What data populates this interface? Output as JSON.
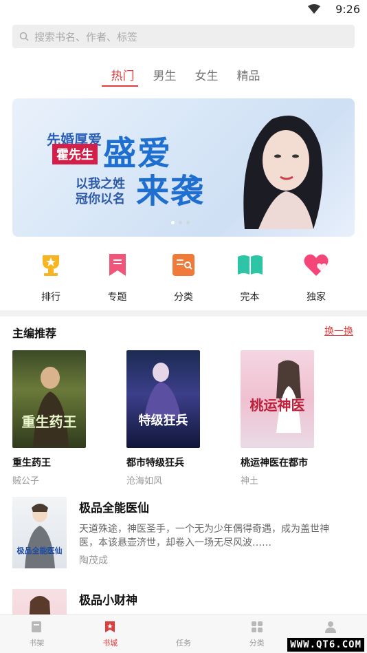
{
  "status": {
    "time": "9:26"
  },
  "search": {
    "placeholder": "搜索书名、作者、标签"
  },
  "tabs": [
    {
      "label": "热门",
      "active": true
    },
    {
      "label": "男生"
    },
    {
      "label": "女生"
    },
    {
      "label": "精品"
    }
  ],
  "banner": {
    "line1": "先婚厚爱",
    "line2": "霍先生",
    "title1": "盛爱",
    "title2": "来袭",
    "sub1": "以我之姓",
    "sub2": "冠你以名"
  },
  "categories": [
    {
      "label": "排行",
      "icon": "trophy-icon",
      "color": "#f7b521"
    },
    {
      "label": "专题",
      "icon": "bookmark-icon",
      "color": "#f0557a"
    },
    {
      "label": "分类",
      "icon": "category-icon",
      "color": "#f07a3a"
    },
    {
      "label": "完本",
      "icon": "open-book-icon",
      "color": "#2ec4a6"
    },
    {
      "label": "独家",
      "icon": "heart-icon",
      "color": "#f5467a"
    }
  ],
  "section": {
    "title": "主编推荐",
    "more": "换一换"
  },
  "grid_books": [
    {
      "name": "重生药王",
      "author": "贼公子",
      "cover_text": "重生药王"
    },
    {
      "name": "都市特级狂兵",
      "author": "沧海如风",
      "cover_text": "特级狂兵"
    },
    {
      "name": "桃运神医在都市",
      "author": "神土",
      "cover_text": "桃运神医"
    }
  ],
  "list_books": [
    {
      "name": "极品全能医仙",
      "desc": "天道殊途，神医圣手，一个无为少年偶得奇遇，成为盖世神医，本该悬壶济世，却卷入一场无尽风波……",
      "author": "陶茂成",
      "cover_text": "极品全能医仙"
    },
    {
      "name": "极品小财神",
      "desc": "",
      "author": "",
      "cover_text": ""
    }
  ],
  "bottom_nav": [
    {
      "label": "书架",
      "icon": "bookshelf-icon"
    },
    {
      "label": "书城",
      "icon": "bookstore-icon",
      "active": true
    },
    {
      "label": "任务",
      "icon": "task-icon"
    },
    {
      "label": "分类",
      "icon": "grid-icon"
    },
    {
      "label": "我的",
      "icon": "user-icon"
    }
  ],
  "watermark": "WWW.QT6.COM",
  "colors": {
    "accent": "#e03c3c"
  }
}
